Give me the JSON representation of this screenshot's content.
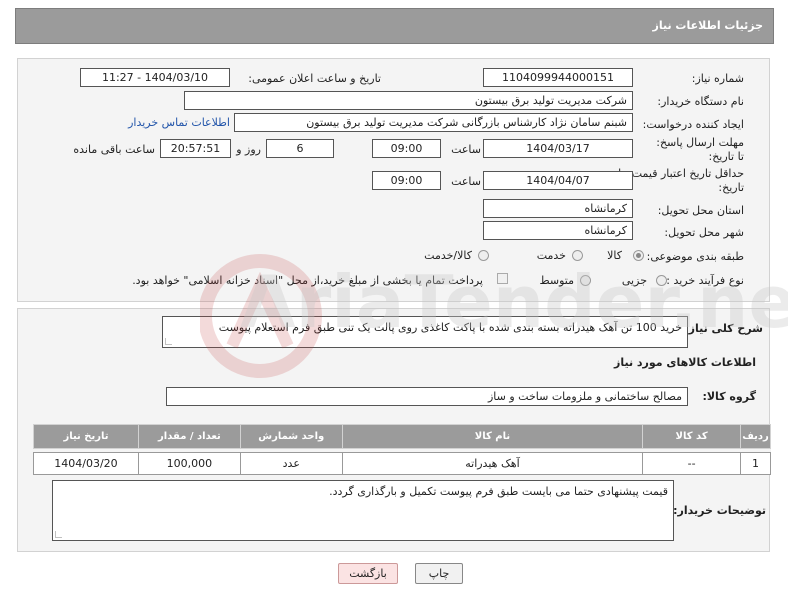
{
  "header": {
    "title": "جزئیات اطلاعات نیاز"
  },
  "form": {
    "need_number": {
      "label": "شماره نیاز:",
      "value": "1104099944000151"
    },
    "announce_datetime": {
      "label": "تاریخ و ساعت اعلان عمومی:",
      "value": "1404/03/10 - 11:27"
    },
    "buyer_org": {
      "label": "نام دستگاه خریدار:",
      "value": "شرکت مدیریت تولید برق بیستون"
    },
    "requester": {
      "label": "ایجاد کننده درخواست:",
      "value": "شبنم سامان نژاد کارشناس بازرگانی شرکت مدیریت تولید برق بیستون"
    },
    "buyer_contact_link": "اطلاعات تماس خریدار",
    "reply_deadline": {
      "label": "مهلت ارسال پاسخ: تا تاریخ:",
      "date": "1404/03/17",
      "time_label": "ساعت",
      "time": "09:00",
      "days": "6",
      "days_label": "روز و",
      "remaining": "20:57:51",
      "remaining_label": "ساعت باقی مانده"
    },
    "price_validity": {
      "label": "حداقل تاریخ اعتبار قیمت: تا تاریخ:",
      "date": "1404/04/07",
      "time_label": "ساعت",
      "time": "09:00"
    },
    "delivery_province": {
      "label": "استان محل تحویل:",
      "value": "کرمانشاه"
    },
    "delivery_city": {
      "label": "شهر محل تحویل:",
      "value": "کرمانشاه"
    },
    "category": {
      "label": "طبقه بندی موضوعی:",
      "options": [
        "کالا",
        "خدمت",
        "کالا/خدمت"
      ],
      "selected": "کالا"
    },
    "purchase_process": {
      "label": "نوع فرآیند خرید :",
      "options": [
        "جزیی",
        "متوسط"
      ],
      "selected": "",
      "payment_note": "پرداخت تمام یا بخشی از مبلغ خرید،از محل \"اسناد خزانه اسلامی\" خواهد بود."
    }
  },
  "summary": {
    "label": "شرح کلی نیاز:",
    "value": "خرید 100 تن آهک هیدراته بسته بندی شده با پاکت کاغذی روی پالت یک تنی طبق فرم استعلام پیوست"
  },
  "goods_info": {
    "title": "اطلاعات کالاهای مورد نیاز",
    "group_label": "گروه کالا:",
    "group_value": "مصالح ساختمانی و ملزومات ساخت و ساز",
    "columns": [
      "ردیف",
      "کد کالا",
      "نام کالا",
      "واحد شمارش",
      "تعداد / مقدار",
      "تاریخ نیاز"
    ],
    "rows": [
      {
        "row": "1",
        "code": "--",
        "name": "آهک هیدراته",
        "unit": "عدد",
        "qty": "100,000",
        "date": "1404/03/20"
      }
    ]
  },
  "buyer_notes": {
    "label": "توضیحات خریدار:",
    "value": "قیمت پیشنهادی حتما می بایست طبق فرم پیوست تکمیل و بارگذاری گردد."
  },
  "buttons": {
    "print": "چاپ",
    "back": "بازگشت"
  },
  "watermark_text": "AriaTender.net",
  "colors": {
    "header_bg": "#9b9b9b",
    "panel_bg": "#f4f4f4",
    "link": "#2255aa",
    "back_button_bg": "#fbe3e3"
  }
}
